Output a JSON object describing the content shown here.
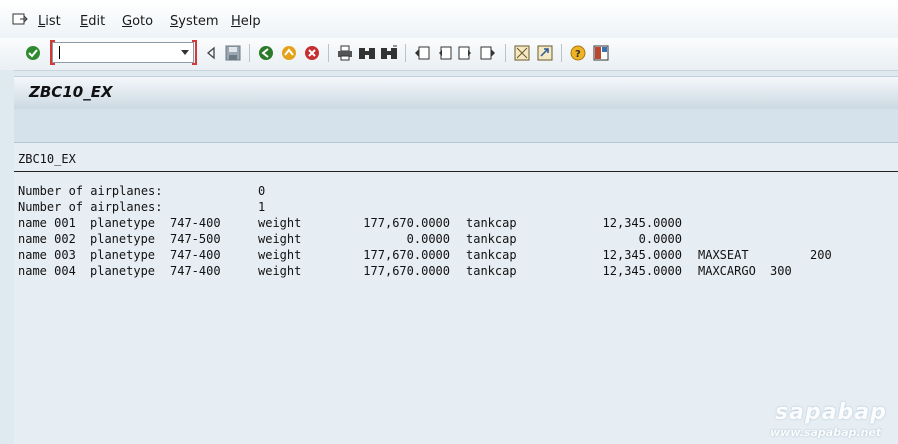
{
  "menu": {
    "items": [
      {
        "first": "L",
        "rest": "ist"
      },
      {
        "first": "E",
        "rest": "dit"
      },
      {
        "first": "G",
        "rest": "oto"
      },
      {
        "first": "S",
        "rest": "ystem"
      },
      {
        "first": "H",
        "rest": "elp"
      }
    ]
  },
  "toolbar": {
    "command_field_value": "",
    "icons": [
      "enter-icon",
      "back-icon",
      "save-icon",
      "back-green-icon",
      "exit-icon",
      "cancel-icon",
      "print-icon",
      "find-icon",
      "find-next-icon",
      "first-page-icon",
      "previous-page-icon",
      "next-page-icon",
      "last-page-icon",
      "create-session-icon",
      "create-shortcut-icon",
      "help-icon",
      "layout-icon"
    ]
  },
  "title": "ZBC10_EX",
  "list": {
    "header": "ZBC10_EX",
    "airplane_counts": [
      {
        "label": "Number of airplanes:",
        "value": "0"
      },
      {
        "label": "Number of airplanes:",
        "value": "1"
      }
    ],
    "rows": [
      {
        "name": "name 001",
        "planetype_label": "planetype",
        "planetype": "747-400",
        "weight_label": "weight",
        "weight": "177,670.0000",
        "tankcap_label": "tankcap",
        "tankcap": "12,345.0000",
        "extra_label": "",
        "extra_value": ""
      },
      {
        "name": "name 002",
        "planetype_label": "planetype",
        "planetype": "747-500",
        "weight_label": "weight",
        "weight": "0.0000",
        "tankcap_label": "tankcap",
        "tankcap": "0.0000",
        "extra_label": "",
        "extra_value": ""
      },
      {
        "name": "name 003",
        "planetype_label": "planetype",
        "planetype": "747-400",
        "weight_label": "weight",
        "weight": "177,670.0000",
        "tankcap_label": "tankcap",
        "tankcap": "12,345.0000",
        "extra_label": "MAXSEAT",
        "extra_value": "200"
      },
      {
        "name": "name 004",
        "planetype_label": "planetype",
        "planetype": "747-400",
        "weight_label": "weight",
        "weight": "177,670.0000",
        "tankcap_label": "tankcap",
        "tankcap": "12,345.0000",
        "extra_label": "MAXCARGO",
        "extra_value": "300"
      }
    ]
  },
  "watermark": {
    "brand": "sapabap",
    "url": "www.sapabap.net"
  }
}
